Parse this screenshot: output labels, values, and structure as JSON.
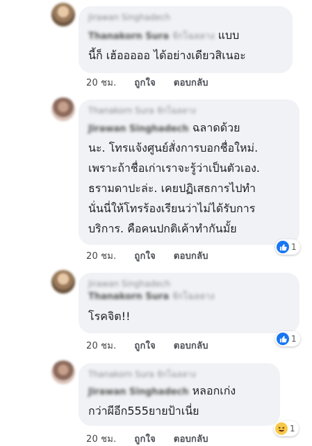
{
  "comments": [
    {
      "author": "Jirawan Singhadech",
      "tag_name": "Thanakorn Sura",
      "tag_suffix": "จักโฉลลาง",
      "tag_tail": "แบบ",
      "lines": [
        "นี้ก็ เฮ้อออออ ได้อย่างเดียวสิเนอะ"
      ],
      "time": "20 ชม.",
      "like_label": "ถูกใจ",
      "reply_label": "ตอบกลับ",
      "reaction_count": ""
    },
    {
      "author": "Thanakorn Sura จักโฉลลาง",
      "tag_name": "Jirawan Singhadech",
      "tag_suffix": "",
      "tag_tail": "ฉลาดด้วย",
      "lines": [
        "นะ. โทรแจ้งศูนย์สั่งการบอกชื่อใหม่.",
        "เพราะถ้าชื่อเก่าเราจะรู้ว่าเป็นตัวเอง.",
        "ธรามดาปะล่ะ. เคยปฏิเสธการไปทำ",
        "นั่นนี่ให้โทรร้องเรียนว่าไม่ได้รับการ",
        "บริการ. คือคนปกติเค้าทำกันมั้ย"
      ],
      "time": "20 ชม.",
      "like_label": "ถูกใจ",
      "reply_label": "ตอบกลับ",
      "reaction_count": "1"
    },
    {
      "author": "Jirawan Singhadech",
      "tag_name": "Thanakorn Sura",
      "tag_suffix": "จักโฉลลาง",
      "tag_tail": "",
      "lines": [
        "โรคจิต!!"
      ],
      "time": "20 ชม.",
      "like_label": "ถูกใจ",
      "reply_label": "ตอบกลับ",
      "reaction_count": "1"
    },
    {
      "author": "Thanakorn Sura จักโฉลลาง",
      "tag_name": "Jirawan Singhadech",
      "tag_suffix": "",
      "tag_tail": "หลอกเก่ง",
      "lines": [
        "กว่าผีอีก555ยายป้าเนี่ย"
      ],
      "time": "20 ชม.",
      "like_label": "ถูกใจ",
      "reply_label": "ตอบกลับ",
      "reaction_count": "1"
    }
  ],
  "colors": {
    "bubble": "#f0f2f5",
    "like_blue": "#1877f2",
    "haha_yellow": "#f7c94a"
  },
  "icons": {
    "like": "thumbs-up-icon",
    "haha": "laughing-face-icon"
  }
}
